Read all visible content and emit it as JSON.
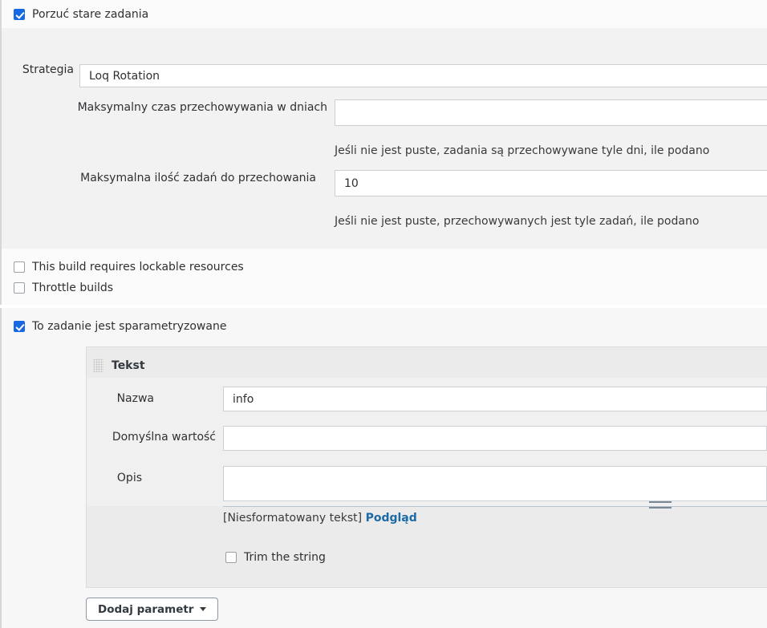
{
  "discard_old": {
    "label": "Porzuć stare zadania",
    "checked": true
  },
  "strategy": {
    "label": "Strategia",
    "value": "Loq Rotation",
    "rows": [
      {
        "label": "Maksymalny czas przechowywania w dniach",
        "value": "",
        "help": "Jeśli nie jest puste, zadania są przechowywane tyle dni, ile podano"
      },
      {
        "label": "Maksymalna ilość zadań do przechowania",
        "value": "10",
        "help": "Jeśli nie jest puste, przechowywanych jest tyle zadań, ile podano"
      }
    ]
  },
  "checkboxes": [
    {
      "label": "This build requires lockable resources",
      "checked": false
    },
    {
      "label": "Throttle builds",
      "checked": false
    }
  ],
  "parameterized": {
    "label": "To zadanie jest sparametryzowane",
    "checked": true
  },
  "parameter": {
    "type_title": "Tekst",
    "drag_handle_icon": "drag-grip-icon",
    "name": {
      "label": "Nazwa",
      "value": "info"
    },
    "default_value": {
      "label": "Domyślna wartość",
      "value": ""
    },
    "description": {
      "label": "Opis",
      "value": ""
    },
    "preview": {
      "format_note": "[Niesformatowany tekst]",
      "link": "Podgląd"
    },
    "trim": {
      "label": "Trim the string",
      "checked": false
    }
  },
  "add_parameter_button": {
    "label": "Dodaj parametr",
    "caret_icon": "chevron-down-icon"
  },
  "colors": {
    "accent_checkbox": "#1668e3",
    "link": "#1b6aa5",
    "panel_gray": "#f2f2f2",
    "card_gray": "#ebebeb"
  }
}
